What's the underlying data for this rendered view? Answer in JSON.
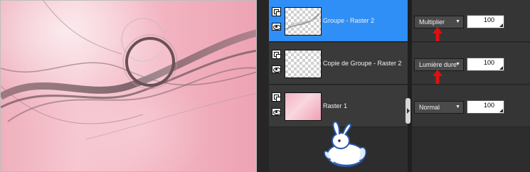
{
  "layers": [
    {
      "name": "Groupe - Raster 2",
      "thumbnail": "transparent-checker",
      "selected": true,
      "blend_mode": "Multiplier",
      "opacity": "100",
      "has_red_arrow": true
    },
    {
      "name": "Copie de Groupe - Raster 2",
      "thumbnail": "transparent-checker",
      "selected": false,
      "blend_mode": "Lumière dure",
      "opacity": "100",
      "has_red_arrow": true
    },
    {
      "name": "Raster 1",
      "thumbnail": "pink-gradient",
      "selected": false,
      "blend_mode": "Normal",
      "opacity": "100",
      "has_red_arrow": false
    }
  ],
  "icons": {
    "group": "layer-group-icon",
    "visibility": "eye-icon",
    "dropdown": "chevron-down-icon",
    "pointer": "red-up-arrow-icon",
    "mascot": "bunny-logo"
  },
  "colors": {
    "selection": "#2f8ff7",
    "canvas_pink": "#f3b5c2",
    "arrow_red": "#e01010"
  }
}
